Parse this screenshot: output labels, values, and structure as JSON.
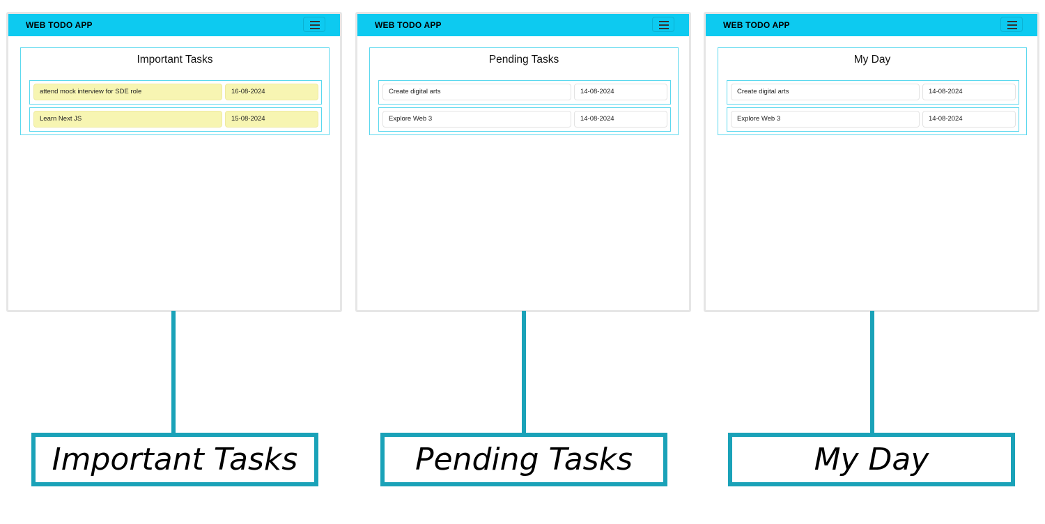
{
  "brand": "WEB TODO APP",
  "colors": {
    "navbar": "#0dcaf0",
    "panel_border": "#5bd8ee",
    "connector": "#1aa2b8",
    "important_bg": "#f7f5b2"
  },
  "icons": {
    "menu": "hamburger-icon"
  },
  "panels": [
    {
      "title": "Important Tasks",
      "tasks": [
        {
          "name": "attend mock interview for SDE role",
          "date": "16-08-2024"
        },
        {
          "name": "Learn Next JS",
          "date": "15-08-2024"
        }
      ]
    },
    {
      "title": "Pending Tasks",
      "tasks": [
        {
          "name": "Create digital arts",
          "date": "14-08-2024"
        },
        {
          "name": "Explore Web 3",
          "date": "14-08-2024"
        }
      ]
    },
    {
      "title": "My Day",
      "tasks": [
        {
          "name": "Create digital arts",
          "date": "14-08-2024"
        },
        {
          "name": "Explore Web 3",
          "date": "14-08-2024"
        }
      ]
    }
  ],
  "captions": [
    "Important Tasks",
    "Pending Tasks",
    "My Day"
  ]
}
